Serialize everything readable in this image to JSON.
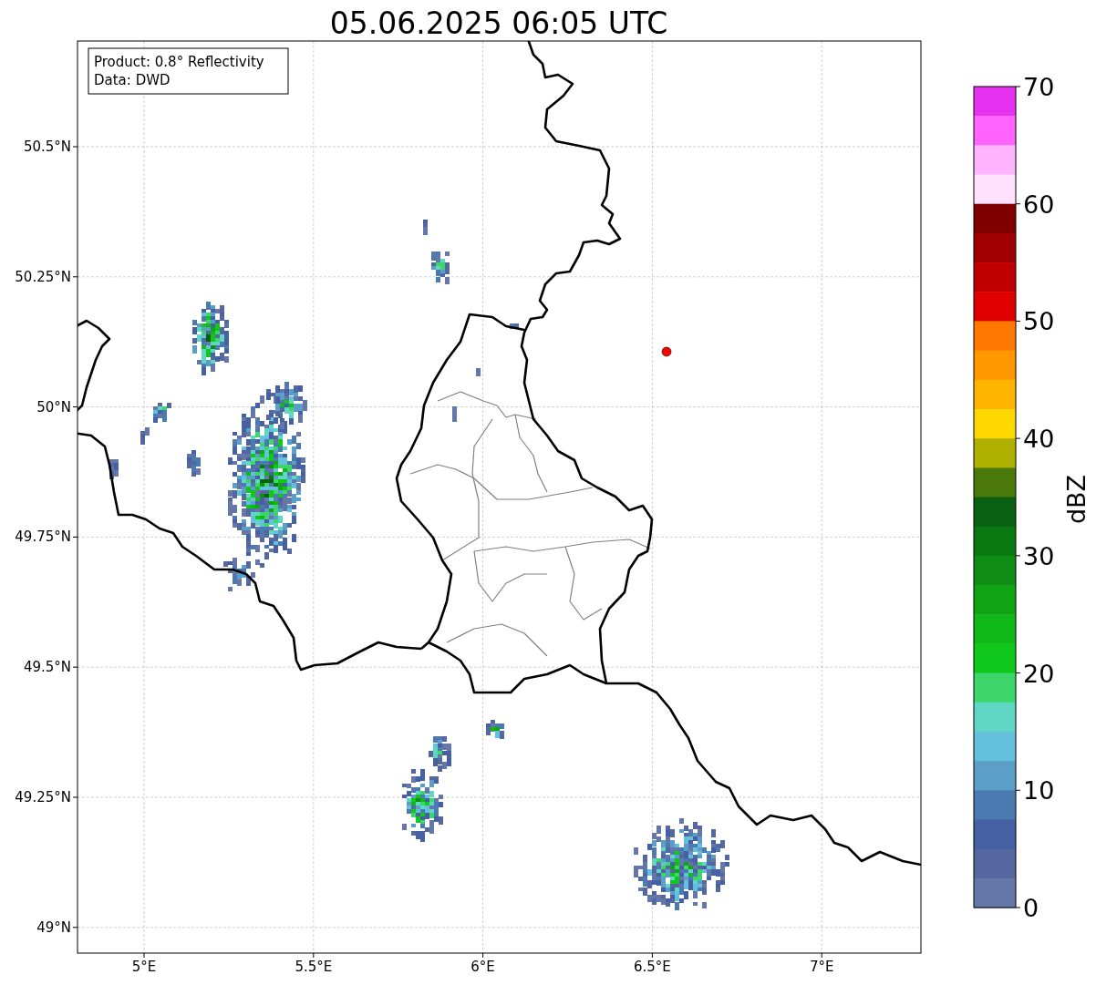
{
  "title": "05.06.2025 06:05 UTC",
  "info_box": {
    "lines": [
      "Product: 0.8° Reflectivity",
      "Data: DWD"
    ]
  },
  "map": {
    "lat_labels": [
      "50.5°N",
      "50.25°N",
      "50°N",
      "49.75°N",
      "49.5°N",
      "49.25°N",
      "49°N"
    ],
    "lon_labels": [
      "5°E",
      "5.5°E",
      "6°E",
      "6.5°E",
      "7°E"
    ]
  },
  "colorbar": {
    "label": "dBZ",
    "ticks": [
      "70",
      "60",
      "50",
      "40",
      "30",
      "20",
      "10",
      "0"
    ],
    "bins": [
      {
        "color": "#e632f0"
      },
      {
        "color": "#ff64ff"
      },
      {
        "color": "#ffb4ff"
      },
      {
        "color": "#ffe0ff"
      },
      {
        "color": "#800000"
      },
      {
        "color": "#a00000"
      },
      {
        "color": "#c00000"
      },
      {
        "color": "#e00000"
      },
      {
        "color": "#ff7800"
      },
      {
        "color": "#ff9800"
      },
      {
        "color": "#ffb400"
      },
      {
        "color": "#ffd800"
      },
      {
        "color": "#b0b000"
      },
      {
        "color": "#4a780a"
      },
      {
        "color": "#086010"
      },
      {
        "color": "#0a7810"
      },
      {
        "color": "#0e8c14"
      },
      {
        "color": "#10a414"
      },
      {
        "color": "#10b818"
      },
      {
        "color": "#10c81c"
      },
      {
        "color": "#3dd66a"
      },
      {
        "color": "#60d6c4"
      },
      {
        "color": "#64c0dc"
      },
      {
        "color": "#5b9fc8"
      },
      {
        "color": "#4a7ab0"
      },
      {
        "color": "#4560a3"
      },
      {
        "color": "#54689f"
      },
      {
        "color": "#6577a8"
      }
    ]
  }
}
